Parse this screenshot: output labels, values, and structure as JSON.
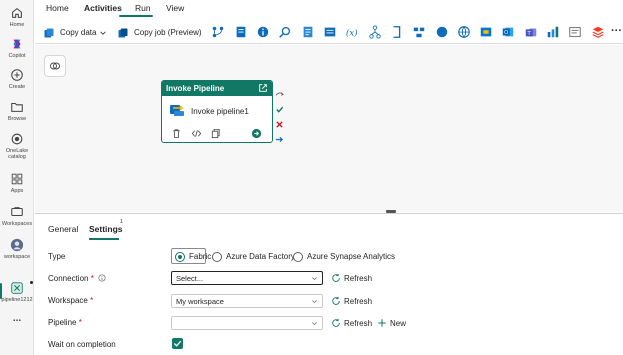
{
  "rail": {
    "items": [
      {
        "label": "Home",
        "icon": "home-icon"
      },
      {
        "label": "Copilot",
        "icon": "copilot-icon"
      },
      {
        "label": "Create",
        "icon": "create-icon"
      },
      {
        "label": "Browse",
        "icon": "browse-icon"
      },
      {
        "label": "OneLake catalog",
        "line1": "OneLake",
        "line2": "catalog",
        "icon": "onelake-icon"
      },
      {
        "label": "Apps",
        "icon": "apps-icon"
      },
      {
        "label": "Workspaces",
        "icon": "workspaces-icon"
      },
      {
        "label": "workspace",
        "icon": "workspace-avatar"
      },
      {
        "label": "pipeline1212",
        "icon": "pipeline-icon"
      },
      {
        "label": "...",
        "icon": "more-icon"
      }
    ]
  },
  "menu": {
    "tabs": [
      "Home",
      "Activities",
      "Run",
      "View"
    ],
    "active": "Activities"
  },
  "toolbar": {
    "copy_data": "Copy data",
    "copy_job": "Copy job (Preview)",
    "more": "···"
  },
  "activity": {
    "type": "Invoke Pipeline",
    "name": "Invoke pipeline1"
  },
  "panel": {
    "tabs": [
      "General",
      "Settings"
    ],
    "active": "Settings",
    "settings_badge": "1",
    "type_label": "Type",
    "type_options": [
      "Fabric",
      "Azure Data Factory",
      "Azure Synapse Analytics"
    ],
    "type_selected": "Fabric",
    "connection_label": "Connection",
    "connection_value": "Select...",
    "workspace_label": "Workspace",
    "workspace_value": "My workspace",
    "pipeline_label": "Pipeline",
    "pipeline_value": "",
    "wait_label": "Wait on completion",
    "wait_checked": true,
    "refresh_label": "Refresh",
    "new_label": "New",
    "required_mark": "*"
  },
  "colors": {
    "accent": "#117865",
    "required": "#c50f1f"
  }
}
